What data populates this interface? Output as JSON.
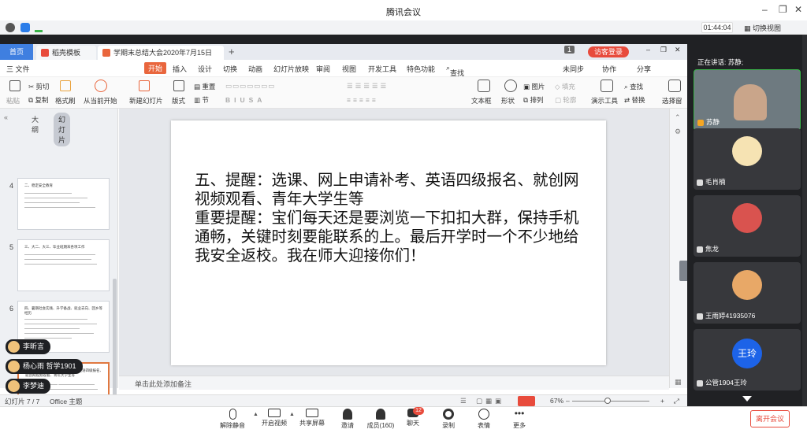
{
  "meeting": {
    "title": "腾讯会议",
    "timer": "01:44:04",
    "switch_view": "切换视图",
    "speaker_note": "正在讲话: 苏静;"
  },
  "wps": {
    "tabs": {
      "home": "首页",
      "template": "稻壳模板",
      "doc": "学期末总结大会2020年7月15日",
      "page_counter": "1",
      "login": "访客登录"
    },
    "menu": [
      "三 文件",
      "开始",
      "插入",
      "设计",
      "切换",
      "动画",
      "幻灯片放映",
      "审阅",
      "视图",
      "开发工具",
      "特色功能",
      "查找"
    ],
    "menu_right": [
      "未同步",
      "协作",
      "分享"
    ],
    "ribbon": {
      "paste": "粘贴",
      "cut": "剪切",
      "copy": "复制",
      "format_painter": "格式刷",
      "from_current": "从当前开始",
      "new_slide": "新建幻灯片",
      "layout": "版式",
      "section": "节",
      "reset": "重置",
      "textbox": "文本框",
      "shape": "形状",
      "picture": "图片",
      "arrange": "排列",
      "fill": "填充",
      "outline": "轮廓",
      "present_tools": "演示工具",
      "find": "查找",
      "replace": "替换",
      "select_pane": "选择窗"
    },
    "panel_tabs": {
      "outline": "大纲",
      "slides": "幻灯片"
    },
    "thumbs": [
      {
        "num": "4",
        "title": "二、稳定安全教育"
      },
      {
        "num": "5",
        "title": "三、大二、大三、毕业班期末各项工作"
      },
      {
        "num": "6",
        "title": "四、暑期社会实践、升学备战、就业去向、回乡等 经历"
      },
      {
        "num": "7",
        "title": "五、提醒：选课、网上申请补考、英语四级报名、就创网视频观看、青年大学生等"
      }
    ],
    "slide_text": "五、提醒：选课、网上申请补考、英语四级报名、就创网视频观看、青年大学生等\n重要提醒：宝们每天还是要浏览一下扣扣大群，保持手机通畅，关键时刻要能联系的上。最后开学时一个不少地给我安全返校。我在师大迎接你们！",
    "notes_placeholder": "单击此处添加备注",
    "status": {
      "slide_pos": "幻灯片 7 / 7",
      "theme": "Office 主题",
      "zoom": "67%"
    }
  },
  "chips": [
    {
      "name": "李昕言"
    },
    {
      "name": "杨心雨 哲学1901"
    },
    {
      "name": "李梦迪"
    }
  ],
  "participants": [
    {
      "name": "苏静",
      "avatar_color": "#7a8a8e"
    },
    {
      "name": "毛肖楠",
      "avatar_color": "#f6e3b3"
    },
    {
      "name": "焦龙",
      "avatar_color": "#d9534f"
    },
    {
      "name": "王雨婷41935076",
      "avatar_color": "#e8a867"
    },
    {
      "name": "公管1904王玲",
      "avatar_text": "王玲"
    }
  ],
  "toolbar": {
    "unmute": "解除静音",
    "video": "开启视频",
    "share": "共享屏幕",
    "invite": "邀请",
    "members": "成员(160)",
    "chat": "聊天",
    "chat_badge": "12",
    "record": "录制",
    "reaction": "表情",
    "more": "更多",
    "leave": "离开会议"
  },
  "colors": {
    "accent_blue": "#3f7fe0",
    "wps_orange": "#e9663d",
    "leave_red": "#e84b3c",
    "dark_bg": "#202124"
  }
}
